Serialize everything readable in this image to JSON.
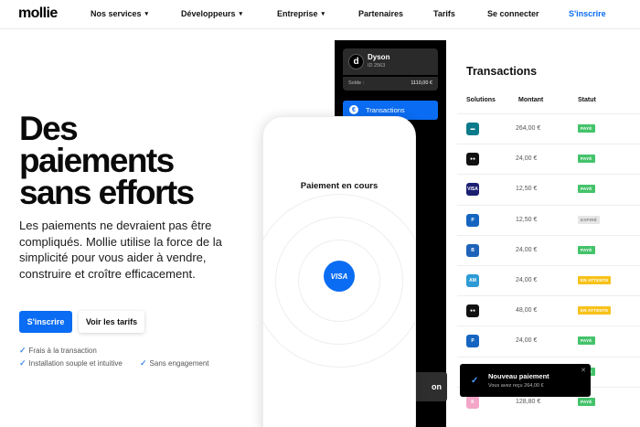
{
  "nav": {
    "logo": "mollie",
    "items": [
      {
        "label": "Nos services",
        "chevron": true
      },
      {
        "label": "Développeurs",
        "chevron": true
      },
      {
        "label": "Entreprise",
        "chevron": true
      },
      {
        "label": "Partenaires",
        "chevron": false
      },
      {
        "label": "Tarifs",
        "chevron": false
      },
      {
        "label": "Se connecter",
        "chevron": false
      }
    ],
    "signup": "S'inscrire"
  },
  "hero": {
    "title": "Des\npaiements\nsans efforts",
    "text": "Les paiements ne devraient pas être compliqués. Mollie utilise la force de la simplicité pour vous aider à vendre, construire et croître efficacement.",
    "cta_primary": "S'inscrire",
    "cta_secondary": "Voir les tarifs",
    "features": [
      "Frais à la transaction",
      "Installation souple et intuitive",
      "Sans engagement"
    ]
  },
  "panel": {
    "account_initial": "d",
    "account_name": "Dyson",
    "account_id": "ID 2563",
    "balance_label": "Solde :",
    "balance_value": "1110,00 €",
    "button_label": "Transactions",
    "partial_button": "on"
  },
  "phone": {
    "title": "Paiement en cours",
    "card_brand": "VISA"
  },
  "transactions": {
    "title": "Transactions",
    "columns": [
      "Solutions",
      "Montant",
      "Statut"
    ],
    "rows": [
      {
        "method": "card-generic",
        "color": "#0b7a8a",
        "amount": "264,00 €",
        "status": "PAYÉ"
      },
      {
        "method": "mastercard",
        "color": "#111111",
        "amount": "24,00 €",
        "status": "PAYÉ"
      },
      {
        "method": "visa",
        "color": "#1a1f71",
        "amount": "12,50 €",
        "status": "PAYÉ"
      },
      {
        "method": "paypal",
        "color": "#1565c0",
        "amount": "12,50 €",
        "status": "EXPIRÉ"
      },
      {
        "method": "bancontact",
        "color": "#1e63b8",
        "amount": "24,00 €",
        "status": "PAYÉ"
      },
      {
        "method": "amex",
        "color": "#2e9bd6",
        "amount": "24,00 €",
        "status": "EN ATTENTE"
      },
      {
        "method": "mastercard",
        "color": "#111111",
        "amount": "48,00 €",
        "status": "EN ATTENTE"
      },
      {
        "method": "paypal",
        "color": "#1565c0",
        "amount": "24,00 €",
        "status": "PAYÉ"
      },
      {
        "method": "card-generic",
        "color": "#2b6f4a",
        "amount": "",
        "status": "PAYÉ"
      },
      {
        "method": "klarna",
        "color": "#f3a6c8",
        "amount": "128,80 €",
        "status": "PAYÉ"
      }
    ],
    "status_colors": {
      "PAYÉ": {
        "bg": "#44c36b",
        "fg": "#ffffff"
      },
      "EXPIRÉ": {
        "bg": "#e6e6e6",
        "fg": "#888888"
      },
      "EN ATTENTE": {
        "bg": "#f7c21b",
        "fg": "#ffffff"
      }
    }
  },
  "toast": {
    "title": "Nouveau paiement",
    "subtitle": "Vous avez reçu 264,00 €"
  }
}
